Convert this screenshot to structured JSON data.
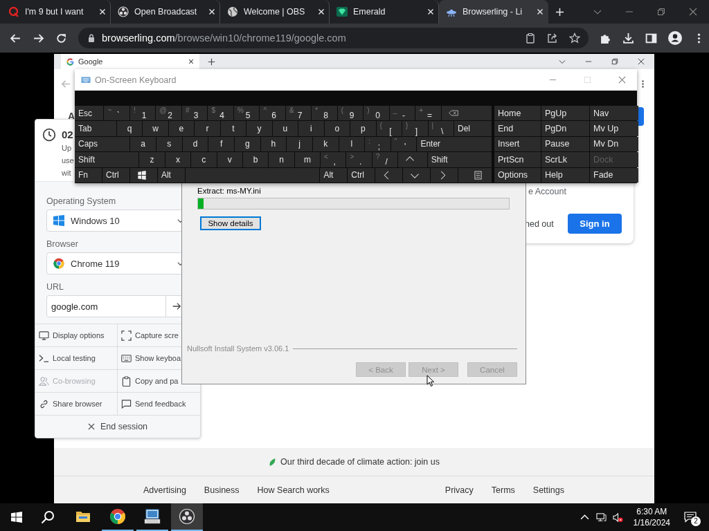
{
  "browser": {
    "tabs": [
      {
        "title": "I'm 9 but I want",
        "kind": "ring",
        "selected": false
      },
      {
        "title": "Open Broadcast",
        "kind": "aperture",
        "selected": false
      },
      {
        "title": "Welcome | OBS",
        "kind": "globe",
        "selected": false
      },
      {
        "title": "Emerald",
        "kind": "gem",
        "selected": false
      },
      {
        "title": "Browserling - Li",
        "kind": "ufo",
        "selected": true
      }
    ],
    "address": {
      "host": "browserling.com",
      "path": "/browse/win10/chrome119/google.com"
    }
  },
  "remote_browser": {
    "tab": {
      "title": "Google"
    }
  },
  "keyboard": {
    "title": "On-Screen Keyboard",
    "rows": [
      {
        "keys": [
          {
            "kind": "esc",
            "label": "Esc"
          },
          {
            "kind": "char",
            "alt": "~",
            "label": "`"
          },
          {
            "kind": "char",
            "alt": "!",
            "label": "1"
          },
          {
            "kind": "char",
            "alt": "@",
            "label": "2"
          },
          {
            "kind": "char",
            "alt": "#",
            "label": "3"
          },
          {
            "kind": "char",
            "alt": "$",
            "label": "4"
          },
          {
            "kind": "char",
            "alt": "%",
            "label": "5"
          },
          {
            "kind": "char",
            "alt": "^",
            "label": "6"
          },
          {
            "kind": "char",
            "alt": "&",
            "label": "7"
          },
          {
            "kind": "char",
            "alt": "*",
            "label": "8"
          },
          {
            "kind": "char",
            "alt": "(",
            "label": "9"
          },
          {
            "kind": "char",
            "alt": ")",
            "label": "0"
          },
          {
            "kind": "char",
            "alt": "_",
            "label": "-"
          },
          {
            "kind": "char",
            "alt": "+",
            "label": "="
          },
          {
            "kind": "backspace"
          }
        ]
      },
      {
        "keys": [
          {
            "kind": "tab",
            "label": "Tab"
          },
          {
            "kind": "char",
            "label": "q"
          },
          {
            "kind": "char",
            "label": "w"
          },
          {
            "kind": "char",
            "label": "e"
          },
          {
            "kind": "char",
            "label": "r"
          },
          {
            "kind": "char",
            "label": "t"
          },
          {
            "kind": "char",
            "label": "y"
          },
          {
            "kind": "char",
            "label": "u"
          },
          {
            "kind": "char",
            "label": "i"
          },
          {
            "kind": "char",
            "label": "o"
          },
          {
            "kind": "char",
            "label": "p"
          },
          {
            "kind": "char",
            "alt": "{",
            "label": "["
          },
          {
            "kind": "char",
            "alt": "}",
            "label": "]"
          },
          {
            "kind": "char",
            "alt": "|",
            "label": "\\"
          },
          {
            "kind": "del",
            "label": "Del"
          }
        ]
      },
      {
        "keys": [
          {
            "kind": "caps",
            "label": "Caps"
          },
          {
            "kind": "char",
            "label": "a"
          },
          {
            "kind": "char",
            "label": "s"
          },
          {
            "kind": "char",
            "label": "d"
          },
          {
            "kind": "char",
            "label": "f"
          },
          {
            "kind": "char",
            "label": "g"
          },
          {
            "kind": "char",
            "label": "h"
          },
          {
            "kind": "char",
            "label": "j"
          },
          {
            "kind": "char",
            "label": "k"
          },
          {
            "kind": "char",
            "label": "l"
          },
          {
            "kind": "char",
            "alt": ":",
            "label": ";"
          },
          {
            "kind": "char",
            "alt": "\"",
            "label": "'"
          },
          {
            "kind": "enter",
            "label": "Enter"
          }
        ]
      },
      {
        "keys": [
          {
            "kind": "shift",
            "label": "Shift"
          },
          {
            "kind": "char",
            "label": "z"
          },
          {
            "kind": "char",
            "label": "x"
          },
          {
            "kind": "char",
            "label": "c"
          },
          {
            "kind": "char",
            "label": "v"
          },
          {
            "kind": "char",
            "label": "b"
          },
          {
            "kind": "char",
            "label": "n"
          },
          {
            "kind": "char",
            "label": "m"
          },
          {
            "kind": "char",
            "alt": "<",
            "label": ","
          },
          {
            "kind": "char",
            "alt": ">",
            "label": "."
          },
          {
            "kind": "char",
            "alt": "?",
            "label": "/"
          },
          {
            "kind": "up"
          },
          {
            "kind": "shift",
            "label": "Shift"
          }
        ]
      },
      {
        "keys": [
          {
            "kind": "fn",
            "label": "Fn"
          },
          {
            "kind": "ctrl",
            "label": "Ctrl"
          },
          {
            "kind": "windows"
          },
          {
            "kind": "alt",
            "label": "Alt"
          },
          {
            "kind": "space"
          },
          {
            "kind": "alt",
            "label": "Alt"
          },
          {
            "kind": "ctrl",
            "label": "Ctrl"
          },
          {
            "kind": "left"
          },
          {
            "kind": "down"
          },
          {
            "kind": "right"
          },
          {
            "kind": "menu"
          }
        ]
      }
    ],
    "side_keys": [
      {
        "label": "Home",
        "disabled": false
      },
      {
        "label": "PgUp",
        "disabled": false
      },
      {
        "label": "Nav",
        "disabled": false
      },
      {
        "label": "End",
        "disabled": false
      },
      {
        "label": "PgDn",
        "disabled": false
      },
      {
        "label": "Mv Up",
        "disabled": false
      },
      {
        "label": "Insert",
        "disabled": false
      },
      {
        "label": "Pause",
        "disabled": false
      },
      {
        "label": "Mv Dn",
        "disabled": false
      },
      {
        "label": "PrtScn",
        "disabled": false
      },
      {
        "label": "ScrLk",
        "disabled": false
      },
      {
        "label": "Dock",
        "disabled": true
      },
      {
        "label": "Options",
        "disabled": false
      },
      {
        "label": "Help",
        "disabled": false
      },
      {
        "label": "Fade",
        "disabled": false
      }
    ]
  },
  "session_panel": {
    "timer": "02",
    "notice_lines": [
      "Up",
      "use",
      "wit"
    ],
    "os": {
      "label": "Operating System",
      "value": "Windows 10"
    },
    "browser": {
      "label": "Browser",
      "value": "Chrome 119"
    },
    "url": {
      "label": "URL",
      "value": "google.com"
    },
    "actions": [
      {
        "label": "Display options",
        "kind": "monitor",
        "disabled": false
      },
      {
        "label": "Capture scre",
        "kind": "capture",
        "disabled": false
      },
      {
        "label": "Local testing",
        "kind": "terminal",
        "disabled": false
      },
      {
        "label": "Show keyboa",
        "kind": "keyboard",
        "disabled": false
      },
      {
        "label": "Co-browsing",
        "kind": "people",
        "disabled": true
      },
      {
        "label": "Copy and pa",
        "kind": "clipboard",
        "disabled": false
      },
      {
        "label": "Share browser",
        "kind": "link",
        "disabled": false
      },
      {
        "label": "Send feedback",
        "kind": "message",
        "disabled": false
      }
    ],
    "end_session": "End session"
  },
  "google": {
    "heading_fragment": "A",
    "account_fragment": "e Account",
    "signed_out_fragment": "ned out",
    "sign_in": "Sign in",
    "footer": {
      "climate": "Our third decade of climate action: join us",
      "links_left": [
        "Advertising",
        "Business",
        "How Search works"
      ],
      "links_right": [
        "Privacy",
        "Terms",
        "Settings"
      ]
    }
  },
  "installer": {
    "status": "Extract: ms-MY.ini",
    "level": 0.018,
    "details_button": "Show details",
    "brand": "Nullsoft Install System v3.06.1",
    "buttons": [
      {
        "label": "< Back",
        "disabled": true
      },
      {
        "label": "Next >",
        "disabled": true
      },
      {
        "label": "Cancel",
        "disabled": true
      }
    ]
  },
  "taskbar": {
    "apps": [
      {
        "kind": "explorer",
        "running": false,
        "selected": false
      },
      {
        "kind": "chrome",
        "running": true,
        "selected": false
      },
      {
        "kind": "osk",
        "running": true,
        "selected": false
      },
      {
        "kind": "obs",
        "running": true,
        "selected": true
      }
    ],
    "time": "6:30 AM",
    "date": "1/16/2024",
    "notifications": "2"
  }
}
